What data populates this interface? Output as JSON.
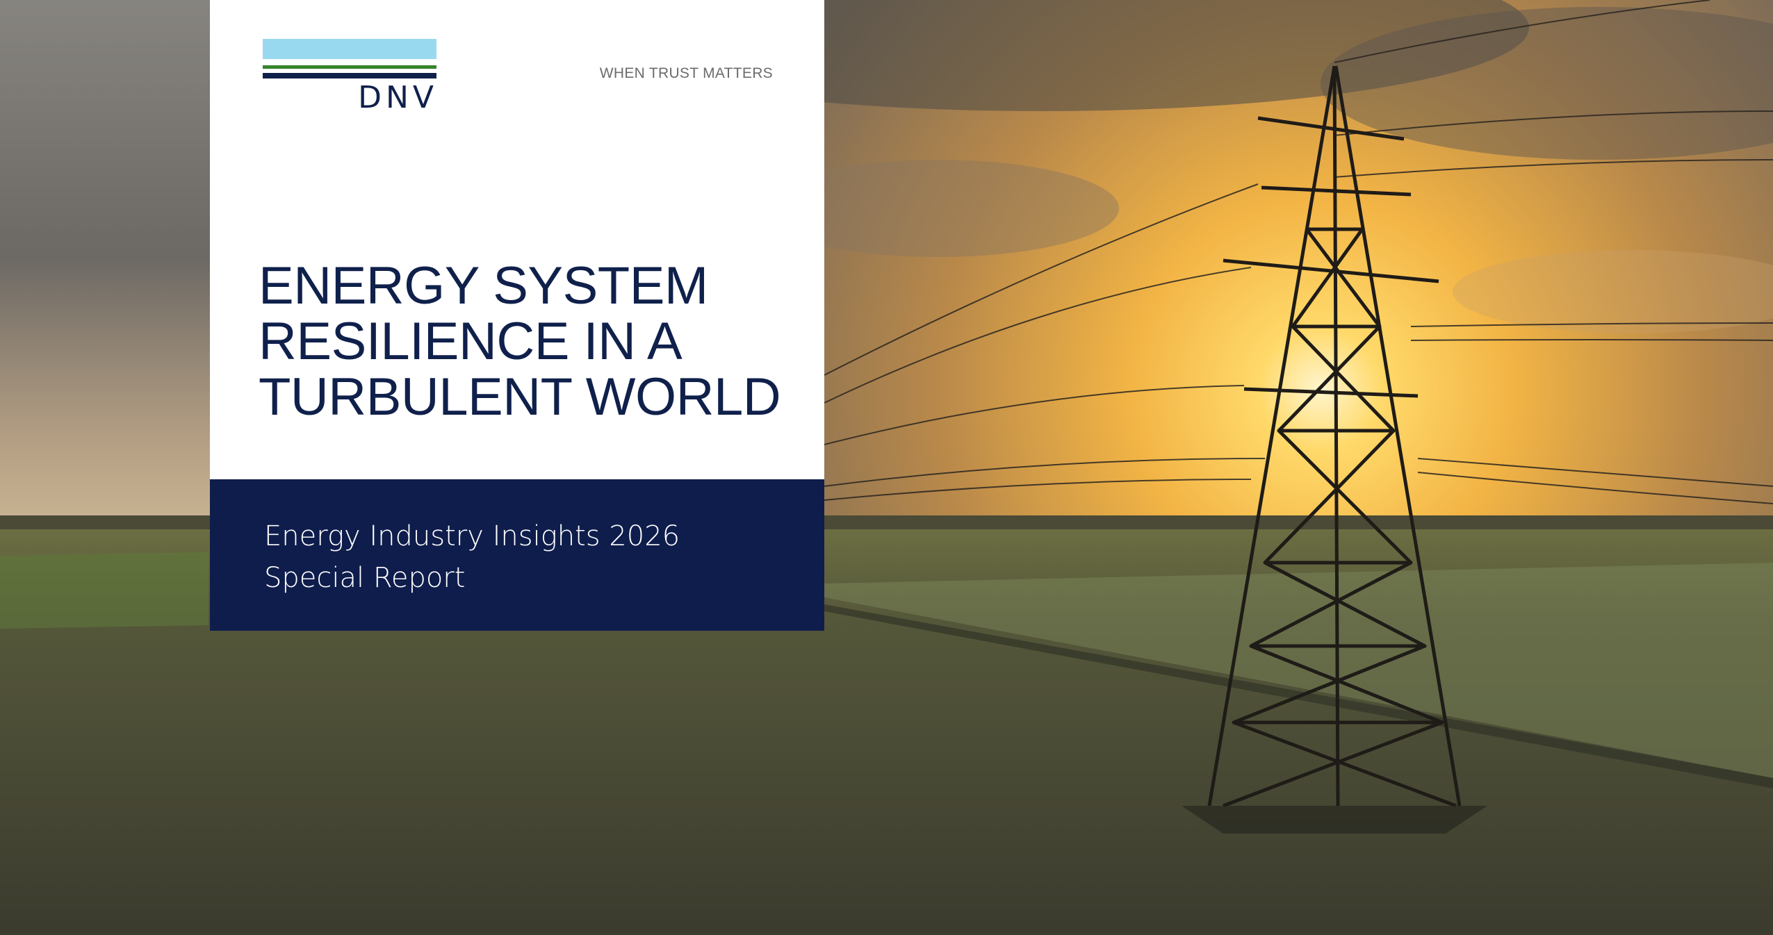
{
  "brand": {
    "wordmark": "DNV",
    "tagline": "WHEN TRUST MATTERS",
    "colors": {
      "navy": "#0f204b",
      "sky": "#99d9f0",
      "green": "#36842d"
    }
  },
  "cover": {
    "title_lines": [
      "ENERGY SYSTEM",
      "RESILIENCE IN A",
      "TURBULENT WORLD"
    ],
    "subtitle_lines": [
      "Energy Industry Insights 2026",
      "Special Report"
    ]
  },
  "background": {
    "scene": "sunset-field-with-power-pylon"
  }
}
